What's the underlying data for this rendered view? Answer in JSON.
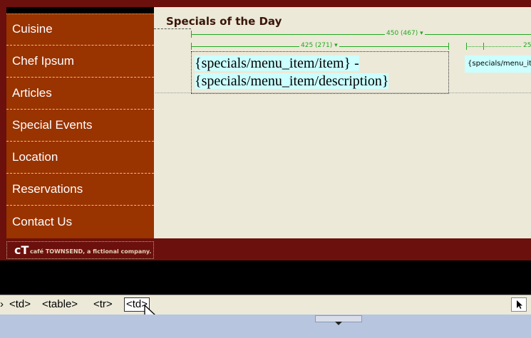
{
  "nav": {
    "items": [
      {
        "label": "Cuisine"
      },
      {
        "label": "Chef Ipsum"
      },
      {
        "label": "Articles"
      },
      {
        "label": "Special Events"
      },
      {
        "label": "Location"
      },
      {
        "label": "Reservations"
      },
      {
        "label": "Contact Us"
      }
    ]
  },
  "content": {
    "title": "Specials of the Day",
    "ruler_outer": "450 (467)",
    "ruler_inner": "425 (271)",
    "ruler_right": "25",
    "cell_line1": "{specials/menu_item/item} -",
    "cell_line2": "{specials/menu_item/description}",
    "right_cell": "{specials/menu_item/price}"
  },
  "footer": {
    "logo_mark": "cT",
    "logo_text": "café TOWNSEND, a fictional company."
  },
  "tagbar": {
    "tags": [
      "‹td›",
      "<td>",
      "<table>",
      "<tr>",
      "<td>"
    ]
  },
  "colors": {
    "sidebar": "#993300",
    "maroon": "#6b100c",
    "content_bg": "#ece9d8",
    "ruler": "#22a822",
    "highlight": "#ccffff"
  }
}
